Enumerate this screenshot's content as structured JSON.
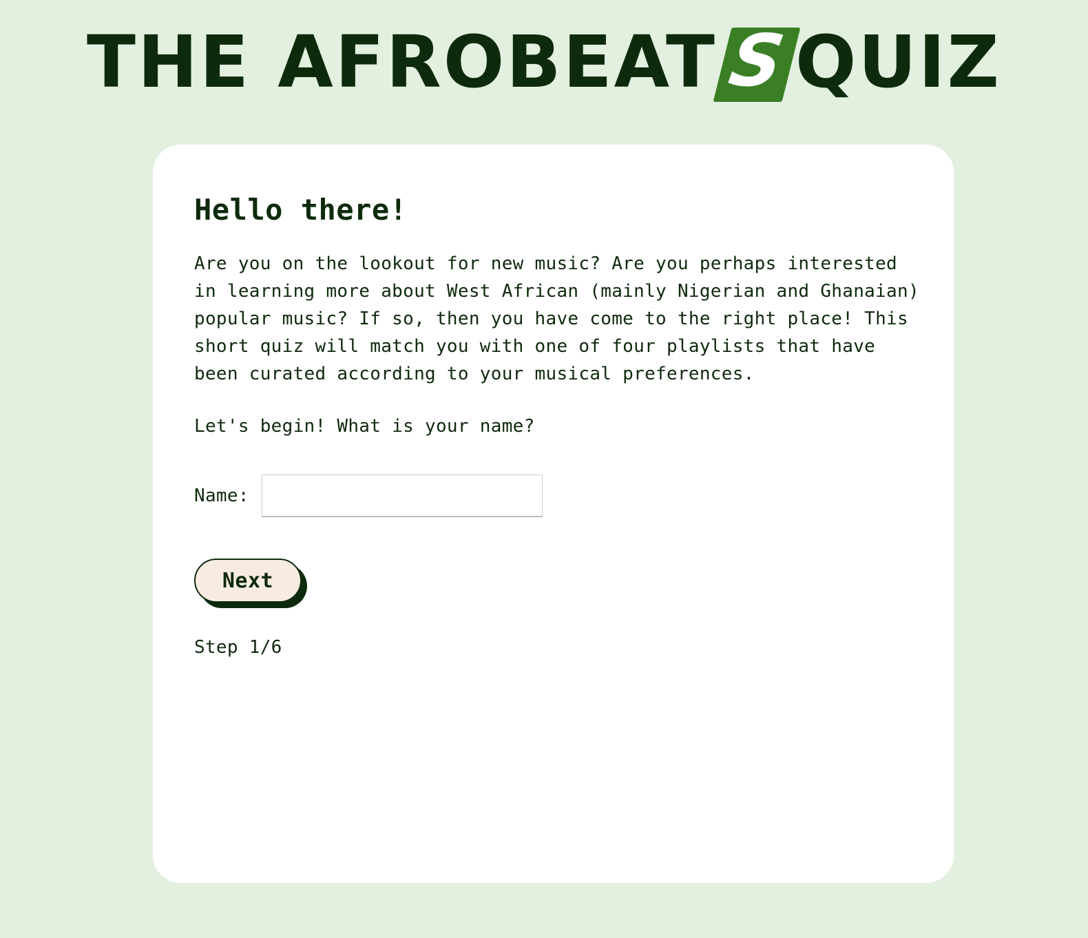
{
  "header": {
    "title_before": "THE AFROBEAT",
    "title_badge": "S",
    "title_after": "QUIZ"
  },
  "card": {
    "heading": "Hello there!",
    "intro": "Are you on the lookout for new music? Are you perhaps interested in learning more about West African (mainly Nigerian and Ghanaian) popular music? If so, then you have come to the right place! This short quiz will match you with one of four playlists that have been curated according to your musical preferences.",
    "prompt": "Let's begin! What is your name?",
    "name_label": "Name:",
    "name_value": "",
    "next_label": "Next",
    "step": "Step 1/6"
  },
  "colors": {
    "background": "#e3f0df",
    "text": "#0e2a0c",
    "accent": "#3a7f25",
    "button_fill": "#f8ece2"
  }
}
